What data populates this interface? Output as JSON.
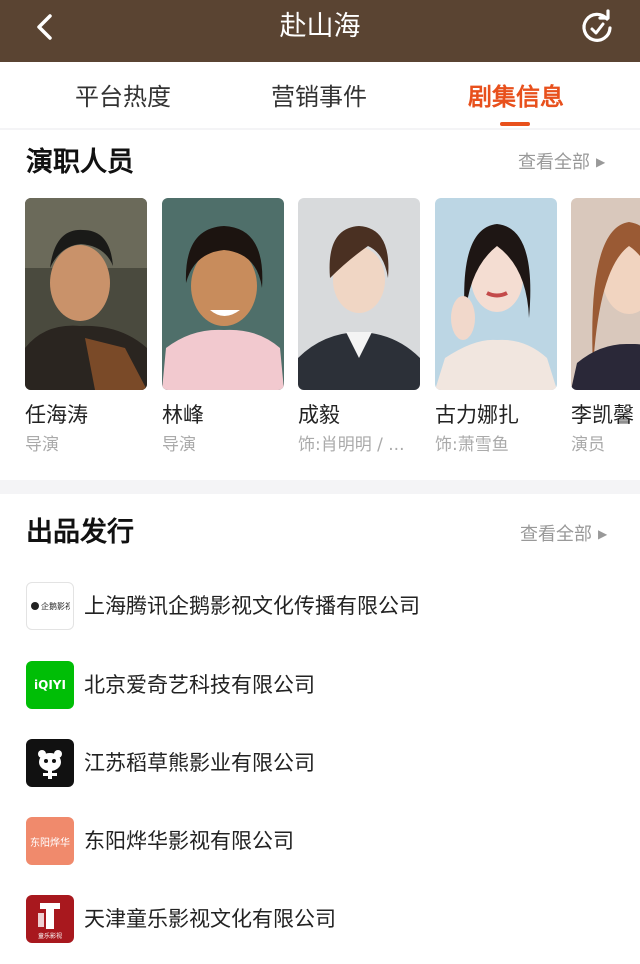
{
  "header": {
    "title": "赴山海"
  },
  "tabs": [
    {
      "label": "平台热度"
    },
    {
      "label": "营销事件"
    },
    {
      "label": "剧集信息"
    }
  ],
  "cast_section": {
    "title": "演职人员",
    "view_all": "查看全部",
    "people": [
      {
        "name": "任海涛",
        "role": "导演"
      },
      {
        "name": "林峰",
        "role": "导演"
      },
      {
        "name": "成毅",
        "role": "饰:肖明明 / ..."
      },
      {
        "name": "古力娜扎",
        "role": "饰:萧雪鱼"
      },
      {
        "name": "李凯馨",
        "role": "演员"
      }
    ]
  },
  "production_section": {
    "title": "出品发行",
    "view_all": "查看全部",
    "companies": [
      {
        "name": "上海腾讯企鹅影视文化传播有限公司",
        "logo_text": "企鹅影视"
      },
      {
        "name": "北京爱奇艺科技有限公司",
        "logo_text": "iQIYI"
      },
      {
        "name": "江苏稻草熊影业有限公司",
        "logo_text": ""
      },
      {
        "name": "东阳烨华影视有限公司",
        "logo_text": "东阳烨华"
      },
      {
        "name": "天津童乐影视文化有限公司",
        "logo_text": "童乐影视"
      }
    ]
  },
  "colors": {
    "header_bg": "#5a4432",
    "accent": "#e8501c",
    "iqiyi_green": "#00be06"
  }
}
